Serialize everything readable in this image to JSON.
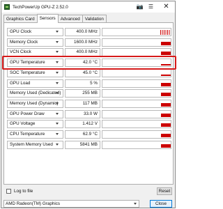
{
  "window": {
    "title": "TechPowerUp GPU-Z 2.52.0"
  },
  "tabs": [
    {
      "label": "Graphics Card"
    },
    {
      "label": "Sensors"
    },
    {
      "label": "Advanced"
    },
    {
      "label": "Validation"
    }
  ],
  "active_tab": "Sensors",
  "sensors": [
    {
      "name": "GPU Clock",
      "value": "400.0 MHz",
      "graph": "ticks"
    },
    {
      "name": "Memory Clock",
      "value": "1600.0 MHz",
      "level": 0.5
    },
    {
      "name": "VCN Clock",
      "value": "400.0 MHz",
      "level": 0.5
    },
    {
      "name": "GPU Temperature",
      "value": "42.0 °C",
      "level": 0.15
    },
    {
      "name": "SOC Temperature",
      "value": "45.0 °C",
      "level": 0.15
    },
    {
      "name": "GPU Load",
      "value": "5 %",
      "level": 0.5
    },
    {
      "name": "Memory Used (Dedicated)",
      "value": "255 MB",
      "level": 0.5
    },
    {
      "name": "Memory Used (Dynamic)",
      "value": "117 MB",
      "level": 0.5
    },
    {
      "name": "GPU Power Draw",
      "value": "33.0 W",
      "level": 0.5
    },
    {
      "name": "GPU Voltage",
      "value": "1.412 V",
      "level": 0.5
    },
    {
      "name": "CPU Temperature",
      "value": "62.9 °C",
      "level": 0.5
    },
    {
      "name": "System Memory Used",
      "value": "5841 MB",
      "level": 0.5
    }
  ],
  "highlighted_sensor": "GPU Temperature",
  "log_to_file": {
    "label": "Log to file",
    "checked": false
  },
  "reset_label": "Reset",
  "gpu_select": {
    "value": "AMD Radeon(TM) Graphics"
  },
  "close_label": "Close",
  "colors": {
    "graph": "#cc0000",
    "highlight": "#d61a1a",
    "accent": "#0078d7"
  },
  "icons": {
    "app": "gpu-z-icon",
    "camera": "camera-icon",
    "menu": "hamburger-icon",
    "close": "close-icon"
  }
}
